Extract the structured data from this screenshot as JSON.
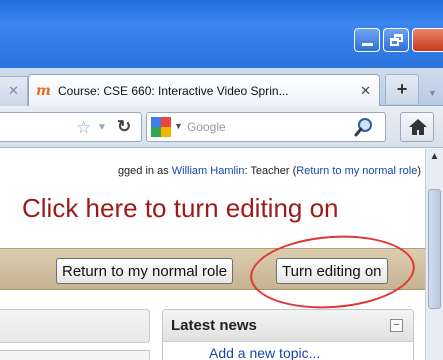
{
  "browser": {
    "tabs": [
      {
        "label": "Course: CSE 660: Interactive Video Sprin...",
        "active": true
      }
    ],
    "new_tab_symbol": "+",
    "search": {
      "placeholder": "Google"
    },
    "window_buttons": [
      "minimize",
      "restore",
      "close"
    ]
  },
  "page": {
    "login": {
      "prefix": "gged in as ",
      "user_name": "William Hamlin",
      "role_text": ": Teacher (",
      "return_link": "Return to my normal role",
      "suffix": ")"
    },
    "edit_hint": "Click here to turn editing on",
    "buttons": {
      "return_role": "Return to my normal role",
      "turn_editing_on": "Turn editing on"
    },
    "latest_news": {
      "title": "Latest news",
      "collapse_symbol": "−",
      "add_topic": "Add a new topic..."
    }
  },
  "colors": {
    "title_bar": "#2a73dd",
    "edit_hint": "#9d1a1a",
    "annotation_circle": "#e23535",
    "link": "#1a45a8"
  }
}
